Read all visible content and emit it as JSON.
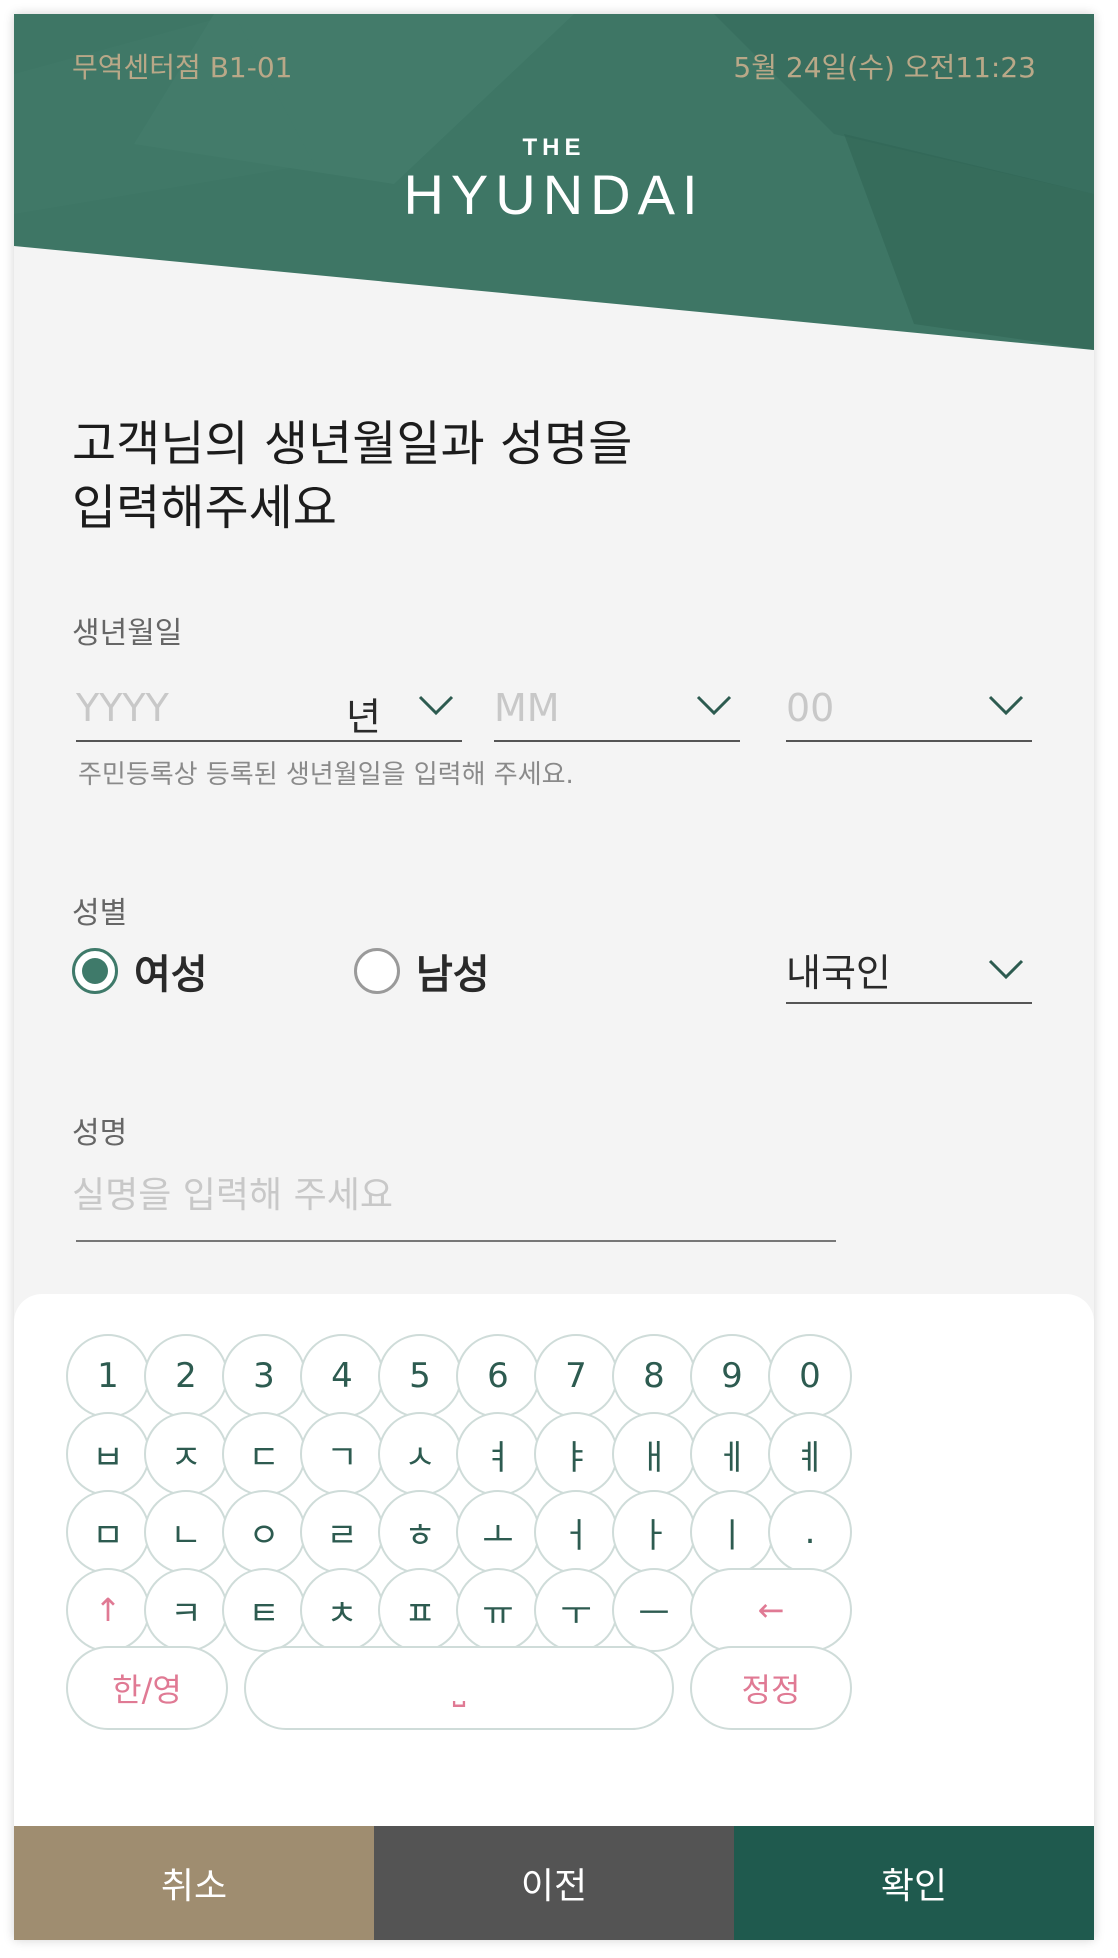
{
  "header": {
    "store": "무역센터점 B1-01",
    "datetime": "5월 24일(수) 오전11:23",
    "logo_small": "THE",
    "logo_main": "HYUNDAI"
  },
  "form": {
    "title_line1": "고객님의 생년월일과 성명을",
    "title_line2": "입력해주세요",
    "birth_label": "생년월일",
    "year_placeholder": "YYYY",
    "year_unit": "년",
    "month_placeholder": "MM",
    "day_placeholder": "00",
    "birth_hint": "주민등록상 등록된 생년월일을 입력해 주세요.",
    "gender_label": "성별",
    "gender_female": "여성",
    "gender_male": "남성",
    "gender_selected": "여성",
    "nationality": "내국인",
    "name_label": "성명",
    "name_placeholder": "실명을 입력해 주세요"
  },
  "keyboard": {
    "row1": [
      "1",
      "2",
      "3",
      "4",
      "5",
      "6",
      "7",
      "8",
      "9",
      "0"
    ],
    "row2": [
      "ㅂ",
      "ㅈ",
      "ㄷ",
      "ㄱ",
      "ㅅ",
      "ㅕ",
      "ㅑ",
      "ㅐ",
      "ㅔ",
      "ㅖ"
    ],
    "row3": [
      "ㅁ",
      "ㄴ",
      "ㅇ",
      "ㄹ",
      "ㅎ",
      "ㅗ",
      "ㅓ",
      "ㅏ",
      "ㅣ",
      "."
    ],
    "row4": [
      "ㅋ",
      "ㅌ",
      "ㅊ",
      "ㅍ",
      "ㅠ",
      "ㅜ",
      "ㅡ"
    ],
    "shift_symbol": "↑",
    "backspace_symbol": "←",
    "lang_toggle": "한/영",
    "space_symbol": "⎵",
    "correct": "정정"
  },
  "footer": {
    "cancel": "취소",
    "prev": "이전",
    "confirm": "확인"
  },
  "colors": {
    "header_green": "#3e7665",
    "brand_gold": "#b9a888",
    "cancel_bg": "#9f8d70",
    "prev_bg": "#545454",
    "confirm_bg": "#1f5a4e",
    "pink": "#e07a94"
  }
}
